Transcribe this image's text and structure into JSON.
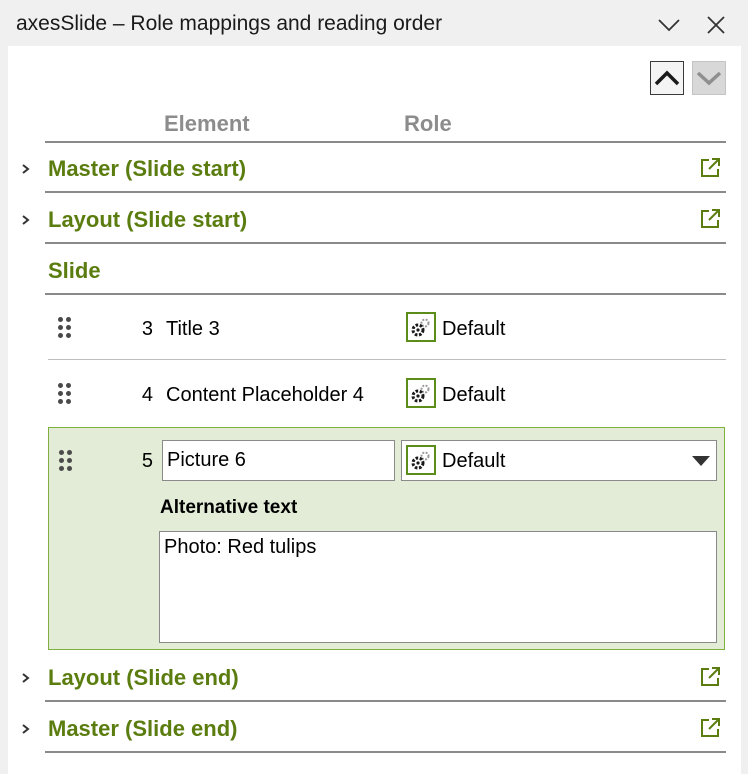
{
  "window": {
    "title": "axesSlide – Role mappings and reading order"
  },
  "columns": {
    "element": "Element",
    "role": "Role"
  },
  "groups_top": [
    {
      "label": "Master (Slide start)"
    },
    {
      "label": "Layout (Slide start)"
    }
  ],
  "slide": {
    "label": "Slide",
    "rows": [
      {
        "number": "3",
        "name": "Title 3",
        "role": "Default"
      },
      {
        "number": "4",
        "name": "Content Placeholder 4",
        "role": "Default"
      }
    ],
    "selected": {
      "number": "5",
      "name": "Picture 6",
      "role": "Default",
      "alt_label": "Alternative text",
      "alt_text": "Photo: Red tulips"
    }
  },
  "groups_bottom": [
    {
      "label": "Layout (Slide end)"
    },
    {
      "label": "Master (Slide end)"
    }
  ],
  "colors": {
    "accent_green": "#5b7d10",
    "selected_bg": "#e3ecd6",
    "selected_border": "#7fb03d"
  },
  "icons": [
    "chevron-down-icon",
    "close-icon",
    "arrow-up-icon",
    "arrow-down-icon",
    "chevron-right-icon",
    "external-link-icon",
    "grip-icon",
    "gear-icon",
    "dropdown-arrow-icon"
  ]
}
